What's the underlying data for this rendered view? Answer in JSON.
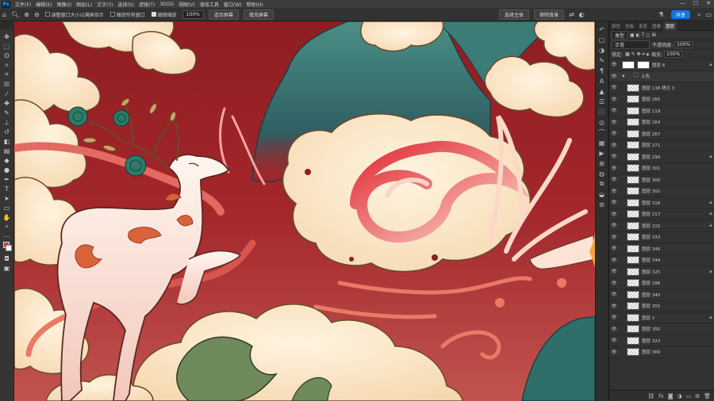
{
  "menubar": {
    "logo": "Ps",
    "items": [
      "文件(F)",
      "编辑(E)",
      "图像(I)",
      "图层(L)",
      "文字(Y)",
      "选择(S)",
      "滤镜(T)",
      "3D(D)",
      "视图(V)",
      "增效工具",
      "窗口(W)",
      "帮助(H)"
    ],
    "window_controls": [
      "—",
      "☐",
      "✕"
    ]
  },
  "options": {
    "check1": "调整窗口大小以满屏显示",
    "check2": "缩放所有窗口",
    "check3": "细微缩放",
    "zoom_value": "100%",
    "fit_screen": "适合屏幕",
    "fill_screen": "填充屏幕",
    "select_subject": "选择主体",
    "remove_bg": "移除背景",
    "share": "共享"
  },
  "toolbar": {
    "tools": [
      "move-tool",
      "marquee-tool",
      "lasso-tool",
      "magic-wand-tool",
      "crop-tool",
      "frame-tool",
      "eyedropper-tool",
      "healing-tool",
      "brush-tool",
      "clone-stamp-tool",
      "history-brush-tool",
      "eraser-tool",
      "gradient-tool",
      "blur-tool",
      "dodge-tool",
      "pen-tool",
      "type-tool",
      "path-select-tool",
      "shape-tool",
      "hand-tool",
      "zoom-tool",
      "more-tools",
      "color-swatches",
      "quick-mask",
      "screen-mode"
    ]
  },
  "panel": {
    "tabs": [
      "颜色",
      "色板",
      "渐变",
      "图案",
      "图层"
    ],
    "active_tab": "图层",
    "filter_kind": "类型",
    "blend_mode": "正常",
    "opacity_label": "不透明度:",
    "opacity_value": "100%",
    "lock_label": "锁定:",
    "fill_label": "填充:",
    "fill_value": "100%",
    "layers": [
      {
        "name": "图层 6",
        "type": "mask",
        "locked": true
      },
      {
        "name": "上色",
        "type": "group",
        "locked": false
      },
      {
        "name": "图层 138 拷贝 3",
        "type": "layer",
        "locked": false
      },
      {
        "name": "图层 265",
        "type": "layer",
        "locked": false
      },
      {
        "name": "图层 119",
        "type": "layer",
        "locked": false
      },
      {
        "name": "图层 264",
        "type": "layer",
        "locked": false
      },
      {
        "name": "图层 267",
        "type": "layer",
        "locked": false
      },
      {
        "name": "图层 271",
        "type": "layer",
        "locked": false
      },
      {
        "name": "图层 299",
        "type": "layer",
        "locked": true
      },
      {
        "name": "图层 301",
        "type": "layer",
        "locked": false
      },
      {
        "name": "图层 300",
        "type": "layer",
        "locked": false
      },
      {
        "name": "图层 302",
        "type": "layer",
        "locked": false
      },
      {
        "name": "图层 318",
        "type": "layer",
        "locked": true
      },
      {
        "name": "图层 217",
        "type": "layer",
        "locked": true
      },
      {
        "name": "图层 315",
        "type": "layer",
        "locked": true
      },
      {
        "name": "图层 333",
        "type": "layer",
        "locked": false
      },
      {
        "name": "图层 346",
        "type": "layer",
        "locked": false
      },
      {
        "name": "图层 344",
        "type": "layer",
        "locked": false
      },
      {
        "name": "图层 325",
        "type": "layer",
        "locked": true
      },
      {
        "name": "图层 188",
        "type": "layer",
        "locked": false
      },
      {
        "name": "图层 345",
        "type": "layer",
        "locked": false
      },
      {
        "name": "图层 355",
        "type": "layer",
        "locked": false
      },
      {
        "name": "图层 2",
        "type": "layer",
        "locked": true
      },
      {
        "name": "图层 350",
        "type": "layer",
        "locked": false
      },
      {
        "name": "图层 323",
        "type": "layer",
        "locked": false
      },
      {
        "name": "图层 369",
        "type": "layer",
        "locked": false
      }
    ],
    "footer_icons": [
      "link-icon",
      "fx-icon",
      "mask-icon",
      "adjustment-icon",
      "folder-icon",
      "new-layer-icon",
      "trash-icon"
    ]
  },
  "colors": {
    "bg_red": "#a6262a",
    "cloud": "#fbe8c9",
    "teal": "#3f7d7a",
    "accent_blue": "#1473e6"
  }
}
